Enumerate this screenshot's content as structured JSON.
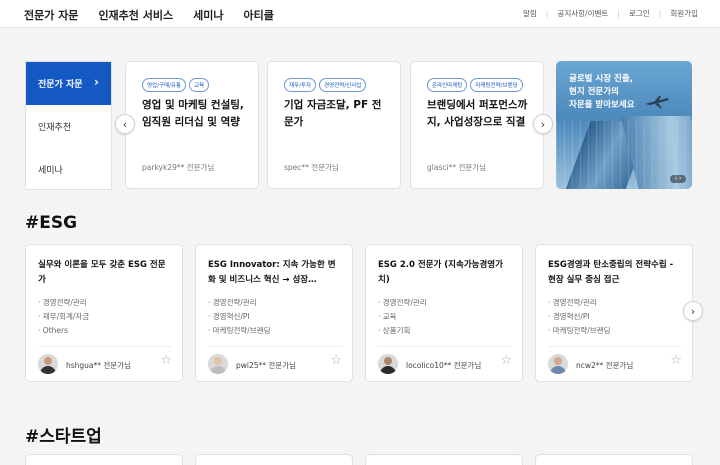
{
  "header": {
    "nav": [
      "전문가 자문",
      "인재추천 서비스",
      "세미나",
      "아티클"
    ],
    "util": [
      "알림",
      "공지사항/이벤트",
      "로그인",
      "회원가입"
    ]
  },
  "sidetabs": [
    {
      "label": "전문가 자문",
      "active": true
    },
    {
      "label": "인재추천",
      "active": false
    },
    {
      "label": "세미나",
      "active": false
    }
  ],
  "top_cards": [
    {
      "tags": [
        "영업/구매/유통",
        "교육"
      ],
      "title": "영업 및 마케팅 컨설팅, 임직원 리더십 및 역량",
      "author": "parkyk29** 전문가님"
    },
    {
      "tags": [
        "재무/투자",
        "경영전략/신사업"
      ],
      "title": "기업 자금조달, PF 전문가",
      "author": "spec** 전문가님"
    },
    {
      "tags": [
        "온라인마케팅",
        "마케팅전략/브랜딩"
      ],
      "title": "브랜딩에서 퍼포먼스까지, 사업성장으로 직결",
      "author": "glasci** 전문가님"
    }
  ],
  "promo": {
    "line1": "글로벌 시장 진출,",
    "line2": "현지 전문가의",
    "line3": "자문을 받아보세요"
  },
  "icons": {
    "prev": "chevron-left-icon",
    "next": "chevron-right-icon",
    "star": "star-outline-icon",
    "plane": "airplane-icon"
  },
  "sections": {
    "esg": "#ESG",
    "startup": "#스타트업"
  },
  "esg_cards": [
    {
      "title": "실무와 이론을 모두 갖춘 ESG 전문가",
      "tags": [
        "경영전략/관리",
        "재무/회계/자금",
        "Others"
      ],
      "author": "hshgua** 전문가님"
    },
    {
      "title": "ESG Innovator: 지속 가능한 변화 및 비즈니스 혁신 → 성장…",
      "tags": [
        "경영전략/관리",
        "경영혁신/PI",
        "마케팅전략/브랜딩"
      ],
      "author": "pwi25** 전문가님"
    },
    {
      "title": "ESG 2.0 전문가 (지속가능경영가치)",
      "tags": [
        "경영전략/관리",
        "교육",
        "상품기획"
      ],
      "author": "locolico10** 전문가님"
    },
    {
      "title": "ESG경영과 탄소중립의 전략수립 - 현장 실무 중심 접근",
      "tags": [
        "경영전략/관리",
        "경영혁신/PI",
        "마케팅전략/브랜딩"
      ],
      "author": "ncw2** 전문가님"
    }
  ],
  "colors": {
    "accent": "#1358c3"
  }
}
